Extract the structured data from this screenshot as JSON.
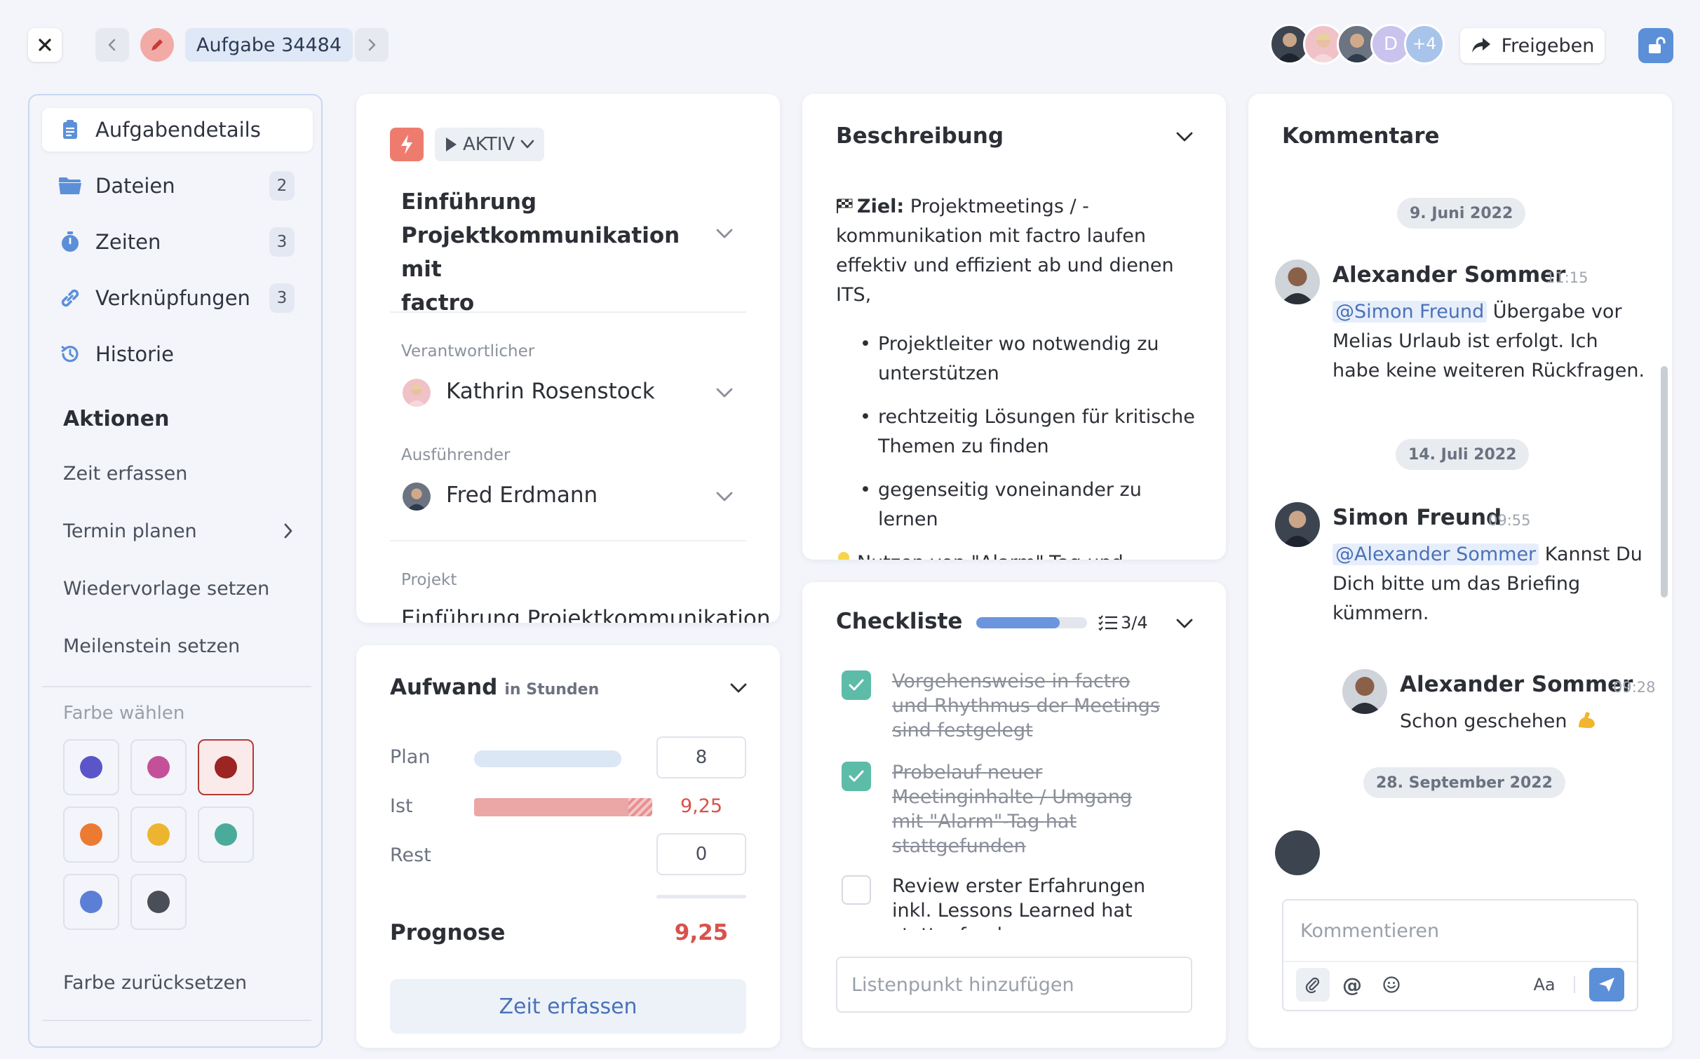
{
  "header": {
    "task_id": "Aufgabe 34484",
    "avatars_more": "+4",
    "avatar_letter": "D",
    "share_label": "Freigeben"
  },
  "sidebar": {
    "items": [
      {
        "label": "Aufgabendetails",
        "icon": "clipboard-icon",
        "count": ""
      },
      {
        "label": "Dateien",
        "icon": "folder-icon",
        "count": "2"
      },
      {
        "label": "Zeiten",
        "icon": "stopwatch-icon",
        "count": "3"
      },
      {
        "label": "Verknüpfungen",
        "icon": "link-icon",
        "count": "3"
      },
      {
        "label": "Historie",
        "icon": "history-icon",
        "count": ""
      }
    ],
    "actions_title": "Aktionen",
    "actions": [
      "Zeit erfassen",
      "Termin planen",
      "Wiedervorlage setzen",
      "Meilenstein setzen"
    ],
    "color_title": "Farbe wählen",
    "colors": [
      "#5a55c8",
      "#c5509a",
      "#9c2423",
      "#ec7a32",
      "#edb52f",
      "#4bab9b",
      "#5b7fd6",
      "#4a4e57"
    ],
    "selected_color": "#9c2423",
    "reset_color": "Farbe zurücksetzen"
  },
  "details": {
    "status": "AKTIV",
    "title_lines": [
      "Einführung",
      "Projektkommunikation mit",
      "factro"
    ],
    "responsible_label": "Verantwortlicher",
    "responsible_name": "Kathrin Rosenstock",
    "executor_label": "Ausführender",
    "executor_name": "Fred Erdmann",
    "project_label": "Projekt",
    "project_value": "Einführung Projektkommunikation"
  },
  "effort": {
    "title": "Aufwand",
    "unit": "in Stunden",
    "plan_label": "Plan",
    "plan_value": "8",
    "actual_label": "Ist",
    "actual_value": "9,25",
    "rest_label": "Rest",
    "rest_value": "0",
    "forecast_label": "Prognose",
    "forecast_value": "9,25",
    "log_time_button": "Zeit erfassen"
  },
  "description": {
    "title": "Beschreibung",
    "goal_label": "Ziel:",
    "goal_lines": [
      " Projektmeetings / -",
      "kommunikation mit factro laufen",
      "effektiv und effizient ab und dienen",
      "ITS,"
    ],
    "bullets": [
      [
        "Projektleiter wo notwendig zu",
        "unterstützen"
      ],
      [
        "rechtzeitig Lösungen für kritische",
        "Themen zu finden"
      ],
      [
        "gegenseitig voneinander zu lernen"
      ]
    ],
    "tip_text": "Nutzen von \"Alarm\"-Tag und"
  },
  "checklist": {
    "title": "Checkliste",
    "progress_text": "3/4",
    "progress_fraction": 0.75,
    "items": [
      {
        "lines": [
          "Vorgehensweise in factro",
          "und Rhythmus der Meetings",
          "sind festgelegt"
        ],
        "done": true
      },
      {
        "lines": [
          "Probelauf neuer",
          "Meetinginhalte / Umgang",
          "mit \"Alarm\"-Tag hat",
          "stattgefunden"
        ],
        "done": true
      },
      {
        "lines": [
          "Review erster Erfahrungen",
          "inkl. Lessons Learned hat",
          "stattgefunden"
        ],
        "done": false
      }
    ],
    "add_placeholder": "Listenpunkt hinzufügen"
  },
  "comments": {
    "title": "Kommentare",
    "dates": [
      "9. Juni 2022",
      "14. Juli 2022",
      "28. September 2022"
    ],
    "entries": [
      {
        "author": "Alexander Sommer",
        "time": "11:15",
        "mention": "@Simon Freund",
        "lines": [
          " Übergabe vor",
          "Melias Urlaub ist erfolgt. Ich",
          "habe keine weiteren Rückfragen."
        ]
      },
      {
        "author": "Simon Freund",
        "time": "09:55",
        "mention": "@Alexander Sommer",
        "lines": [
          " Kannst Du",
          "Dich bitte um das Briefing",
          "kümmern."
        ]
      },
      {
        "author": "Alexander Sommer",
        "time": "09:28",
        "text": "Schon geschehen"
      }
    ],
    "input_placeholder": "Kommentieren",
    "format_label": "Aa"
  }
}
